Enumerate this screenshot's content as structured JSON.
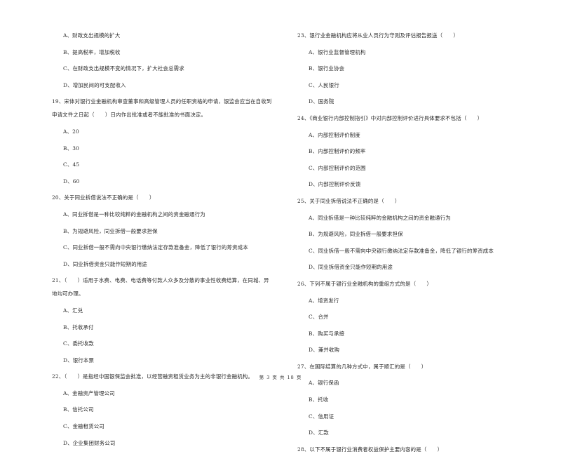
{
  "page": {
    "footer": "第 3 页 共 18 页"
  },
  "left_column": {
    "q18_options": [
      "A、财政支出规模的扩大",
      "B、提高税率，增加税收",
      "C、在财政支出规模不变的情况下，扩大社会总需求",
      "D、增加民间的可支配收入"
    ],
    "q19": {
      "stem_line1": "19、宋体对银行业金融机构审查董事和高级管理人员的任职资格的申请，银监会应当在自收到",
      "stem_line2": "申请文件之日起（　　）日内作出批准或者不能批准的书面决定。",
      "options": [
        "A、20",
        "B、30",
        "C、45",
        "D、60"
      ]
    },
    "q20": {
      "stem": "20、关于同业拆借说法不正确的是（　　）",
      "options": [
        "A、同业拆借是一种比较纯粹的金融机构之间的资金融通行为",
        "B、为规避风险，同业拆借一般要求担保",
        "C、同业拆借一般不需向中央银行缴纳法定存款准备金，降低了银行的筹资成本",
        "D、同业拆借资金只能作短期的用途"
      ]
    },
    "q21": {
      "stem_line1": "21、（　　）适用于水费、电费、电话费等付款人众多及分散的事业性收费结算，在同城、异",
      "stem_line2": "地均可办理。",
      "options": [
        "A、汇兑",
        "B、托收承付",
        "C、委托收款",
        "D、银行本票"
      ]
    },
    "q22": {
      "stem": "22、（　　）是指经中国银保监会批准，以经营融资租赁业务为主的非银行金融机构。",
      "options": [
        "A、金融资产管理公司",
        "B、信托公司",
        "C、金融租赁公司",
        "D、企业集团财务公司"
      ]
    }
  },
  "right_column": {
    "q23": {
      "stem": "23、银行业金融机构应将从业人员行为守则及评估报告报送（　　）",
      "options": [
        "A、银行业监督管理机构",
        "B、银行业协会",
        "C、人民银行",
        "D、国务院"
      ]
    },
    "q24": {
      "stem": "24、《商业银行内部控制指引》中对内部控制评价进行具体要求不包括（　　）",
      "options": [
        "A、内部控制评价制度",
        "B、内部控制评价的频率",
        "C、内部控制评价的范围",
        "D、内部控制评价反馈"
      ]
    },
    "q25": {
      "stem": "25、关于同业拆借说法不正确的是（　　）",
      "options": [
        "A、同业拆借是一种比较纯粹的金融机构之间的资金融通行为",
        "B、为规避风险，同业拆借一般要求担保",
        "C、同业拆借一般不需向中央银行缴纳法定存款准备金，降低了银行的筹资成本",
        "D、同业拆借资金只能作短期的用途"
      ]
    },
    "q26": {
      "stem": "26、下列不属于银行业金融机构的重组方式的是（　　）",
      "options": [
        "A、增资发行",
        "C、合并",
        "B、购买与承接",
        "D、兼并收购"
      ]
    },
    "q27": {
      "stem": "27、在国际结算的几种方式中，属于顺汇的是（　　）",
      "options": [
        "A、银行保函",
        "B、托收",
        "C、信用证",
        "D、汇款"
      ]
    },
    "q28": {
      "stem": "28、以下不属于银行业消费者权益保护主要内容的是（　　）"
    }
  }
}
